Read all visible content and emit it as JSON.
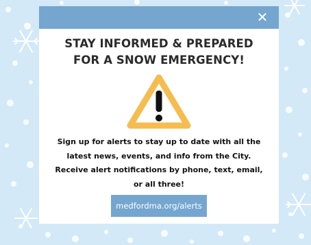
{
  "background": {
    "color": "#d3e9f7",
    "decoration": "snowflakes-and-snow-dots"
  },
  "modal": {
    "header_color": "#74a6cf",
    "close_icon": "close-icon",
    "close_glyph": "✕",
    "headline": {
      "line1": "STAY INFORMED & PREPARED",
      "line2": "FOR A SNOW EMERGENCY!"
    },
    "warning_icon": "warning-triangle-icon",
    "warning_color": "#f7bc4f",
    "body_lines": [
      "Sign up for alerts to stay up to date with all the",
      "latest news, events, and info from the City.",
      "Receive alert notifications by phone, text, email,",
      "or all three!"
    ],
    "link_label": "medfordma.org/alerts",
    "link_color": "#74a6cf"
  }
}
